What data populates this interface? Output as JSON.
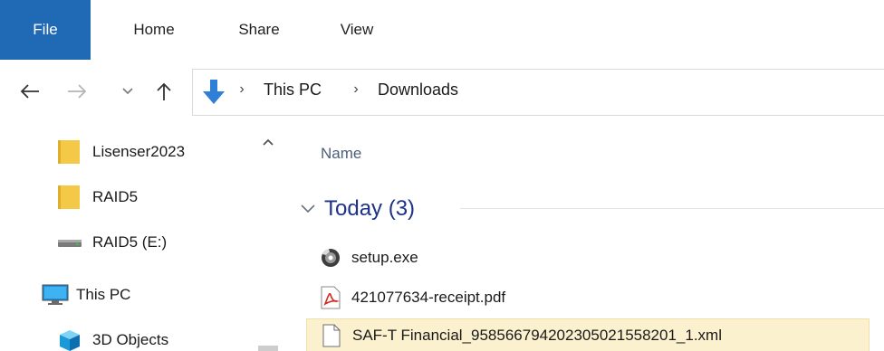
{
  "ribbon": {
    "tabs": [
      {
        "label": "File"
      },
      {
        "label": "Home"
      },
      {
        "label": "Share"
      },
      {
        "label": "View"
      }
    ],
    "active_color": "#1f69b5"
  },
  "navigation": {
    "back_icon": "back-arrow-icon",
    "forward_icon": "forward-arrow-icon",
    "recent_icon": "chevron-down-icon",
    "up_icon": "up-arrow-icon"
  },
  "address": {
    "location_icon": "downloads-icon",
    "crumbs": [
      "This PC",
      "Downloads"
    ],
    "separator": "›"
  },
  "nav_pane": {
    "items": [
      {
        "label": "Lisenser2023",
        "icon": "folder-icon"
      },
      {
        "label": "RAID5",
        "icon": "folder-icon"
      },
      {
        "label": "RAID5 (E:)",
        "icon": "drive-icon"
      },
      {
        "label": "This PC",
        "icon": "computer-icon"
      },
      {
        "label": "3D Objects",
        "icon": "3d-objects-icon"
      }
    ]
  },
  "content": {
    "column_header": "Name",
    "group": {
      "label": "Today (3)"
    },
    "files": [
      {
        "name": "setup.exe",
        "icon": "setup-exe-icon"
      },
      {
        "name": "421077634-receipt.pdf",
        "icon": "pdf-icon"
      },
      {
        "name": "SAF-T Financial_958566794202305021558201_1.xml",
        "icon": "file-icon",
        "selected": true
      }
    ]
  },
  "colors": {
    "folder": "#f3c947",
    "group_header": "#1e3287",
    "selection_bg": "#fcf1cf",
    "downloads_arrow": "#2f7ed8"
  }
}
